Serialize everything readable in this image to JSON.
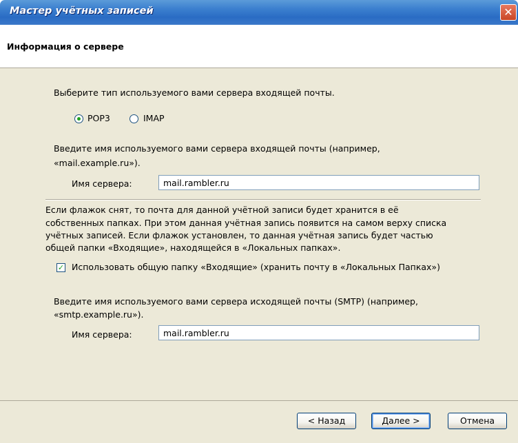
{
  "window": {
    "title": "Мастер учётных записей",
    "close_glyph": "✕"
  },
  "header": {
    "title": "Информация о сервере"
  },
  "incoming": {
    "type_prompt": "Выберите тип используемого вами сервера входящей почты.",
    "pop3_label": "POP3",
    "imap_label": "IMAP",
    "selected_type": "POP3",
    "server_prompt_line1": "Введите имя используемого вами сервера входящей почты (например,",
    "server_prompt_line2": "«mail.example.ru»).",
    "server_label": "Имя сервера:",
    "server_value": "mail.rambler.ru"
  },
  "inbox_info": {
    "line1": "Если флажок снят, то почта для данной учётной записи будет хранится в её",
    "line2": "собственных папках. При этом данная учётная запись появится на самом верху списка",
    "line3": "учётных записей. Если флажок установлен, то данная учётная запись будет частью",
    "line4": "общей папки «Входящие», находящейся в «Локальных папках».",
    "checkbox_label": "Использовать общую папку «Входящие» (хранить почту в «Локальных Папках»)",
    "checkbox_checked": true
  },
  "outgoing": {
    "server_prompt_line1": "Введите имя используемого вами сервера исходящей почты (SMTP) (например,",
    "server_prompt_line2": "«smtp.example.ru»).",
    "server_label": "Имя сервера:",
    "server_value": "mail.rambler.ru"
  },
  "buttons": {
    "back_label": "< Назад",
    "next_label": "Далее >",
    "cancel_label": "Отмена"
  },
  "colors": {
    "titlebar": "#2a6cc4",
    "dialog_bg": "#ece9d8",
    "check_accent": "#21a121"
  }
}
